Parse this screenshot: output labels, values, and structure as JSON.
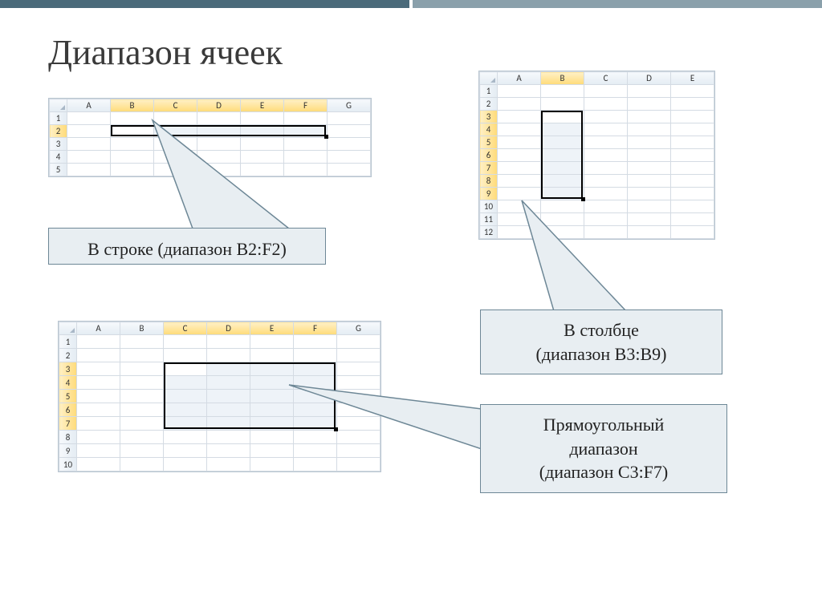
{
  "title": "Диапазон ячеек",
  "excel1": {
    "cols": [
      "A",
      "B",
      "C",
      "D",
      "E",
      "F",
      "G"
    ],
    "rows": [
      "1",
      "2",
      "3",
      "4",
      "5"
    ],
    "activeCols": [
      "B",
      "C",
      "D",
      "E",
      "F"
    ],
    "activeRows": [
      "2"
    ]
  },
  "excel2": {
    "cols": [
      "A",
      "B",
      "C",
      "D",
      "E"
    ],
    "rows": [
      "1",
      "2",
      "3",
      "4",
      "5",
      "6",
      "7",
      "8",
      "9",
      "10",
      "11",
      "12"
    ],
    "activeCols": [
      "B"
    ],
    "activeRows": [
      "3",
      "4",
      "5",
      "6",
      "7",
      "8",
      "9"
    ]
  },
  "excel3": {
    "cols": [
      "A",
      "B",
      "C",
      "D",
      "E",
      "F",
      "G"
    ],
    "rows": [
      "1",
      "2",
      "3",
      "4",
      "5",
      "6",
      "7",
      "8",
      "9",
      "10"
    ],
    "activeCols": [
      "C",
      "D",
      "E",
      "F"
    ],
    "activeRows": [
      "3",
      "4",
      "5",
      "6",
      "7"
    ]
  },
  "callout1": "В строке (диапазон  B2:F2)",
  "callout2_line1": "В столбце",
  "callout2_line2": "(диапазон  B3:B9)",
  "callout3_line1": "Прямоугольный",
  "callout3_line2": "диапазон",
  "callout3_line3": "(диапазон  C3:F7)"
}
